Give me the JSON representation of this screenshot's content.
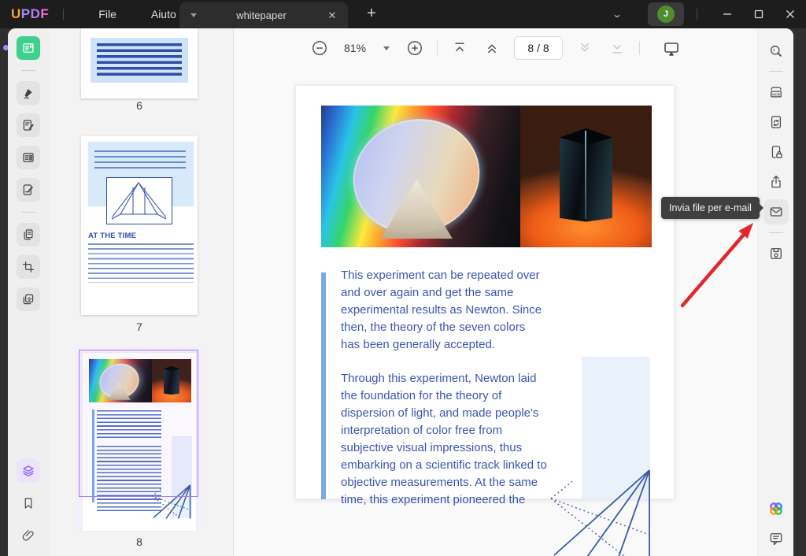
{
  "titlebar": {
    "logo_text": "UPDF",
    "logo_letters": [
      "U",
      "P",
      "D",
      "F"
    ],
    "menu_file": "File",
    "menu_help": "Aiuto",
    "tab_title": "whitepaper",
    "tab_close_glyph": "✕",
    "tab_new_glyph": "+",
    "collapse_glyph": "⌄",
    "avatar_initial": "J",
    "minimize_icon": "minimize-icon",
    "maximize_icon": "maximize-icon",
    "close_icon": "close-icon"
  },
  "toolbar": {
    "zoom_level": "81%",
    "page_indicator": "8 / 8",
    "buttons": [
      "zoom-out",
      "zoom-menu",
      "zoom-in",
      "go-first-page",
      "previous-page",
      "page-box",
      "next-page",
      "go-last-page",
      "presentation-mode"
    ]
  },
  "sidebar_left": {
    "items": [
      "reader-mode",
      "comment",
      "edit-pdf",
      "forms",
      "sign",
      "organize-pages",
      "crop",
      "watermark"
    ],
    "bottom_items": [
      "layers",
      "bookmark",
      "attachment"
    ],
    "active_item": "reader-mode"
  },
  "sidebar_right": {
    "items": [
      "search",
      "ocr",
      "convert",
      "protect",
      "share",
      "send-email",
      "save"
    ],
    "bottom_items": [
      "ai-assistant",
      "feedback"
    ],
    "highlighted_item": "send-email",
    "ocr_label": "OCR"
  },
  "right_tooltip": {
    "text": "Invia file per e-mail"
  },
  "thumbnails": [
    {
      "label": "6"
    },
    {
      "label": "7",
      "heading": "AT THE TIME"
    },
    {
      "label": "8",
      "selected": true
    }
  ],
  "document_page": {
    "paragraph_1": "This experiment can be repeated over and over again and get the same experimental results as Newton. Since then, the theory of the seven colors has been generally accepted.",
    "paragraph_2": "Through this experiment, Newton laid the foundation for the theory of dispersion of light, and made people's interpretation of color free from subjective visual impressions, thus embarking on a scientific track linked to objective measurements. At the same time, this experiment pioneered the"
  },
  "colors": {
    "accent_green": "#3ed18e",
    "accent_purple": "#8b5cf6",
    "arrow_red": "#e2262c",
    "doc_text_blue": "#3956b3",
    "tooltip_bg": "#3f3f3f"
  }
}
